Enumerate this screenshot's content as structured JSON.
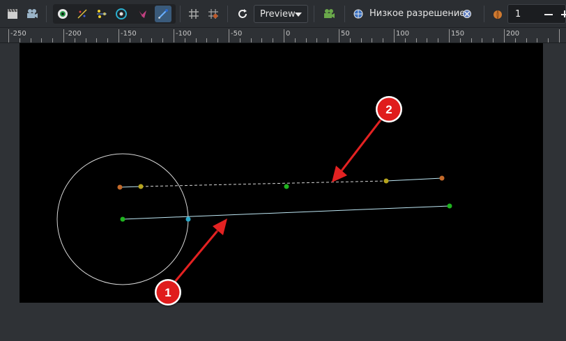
{
  "toolbar": {
    "icons": [
      "clapperboard-icon",
      "camera-icon",
      "eye-onion-icon",
      "sparkle-icon",
      "stars-icon",
      "rotate-icon",
      "bird-icon",
      "pen-icon",
      "grid-icon",
      "transform-grid-icon",
      "refresh-icon"
    ],
    "preview_label": "Preview",
    "render_icon": "camera-render-icon",
    "lowres_icon": "globe-icon",
    "lowres_label": "Низкое разрешение",
    "lowres_toggle_icon": "toggle-off-icon",
    "onion_icon": "onion-skin-icon",
    "onion_value": "1"
  },
  "ruler": {
    "labels": [
      "-250",
      "-200",
      "-150",
      "-100",
      "-50",
      "0",
      "50",
      "100",
      "150",
      "200"
    ]
  },
  "annotations": {
    "badge_1": "1",
    "badge_2": "2"
  },
  "colors": {
    "canvas_bg": "#000000",
    "spline_solid": "#bfe8f5",
    "spline_dashed": "#d8d8d8",
    "circle": "#d8d8d8",
    "handle_green": "#1fb31f",
    "handle_orange": "#c46a2a",
    "handle_yellow": "#b7a51e",
    "handle_cyan": "#2aa8c8",
    "arrow_red": "#e32020"
  }
}
